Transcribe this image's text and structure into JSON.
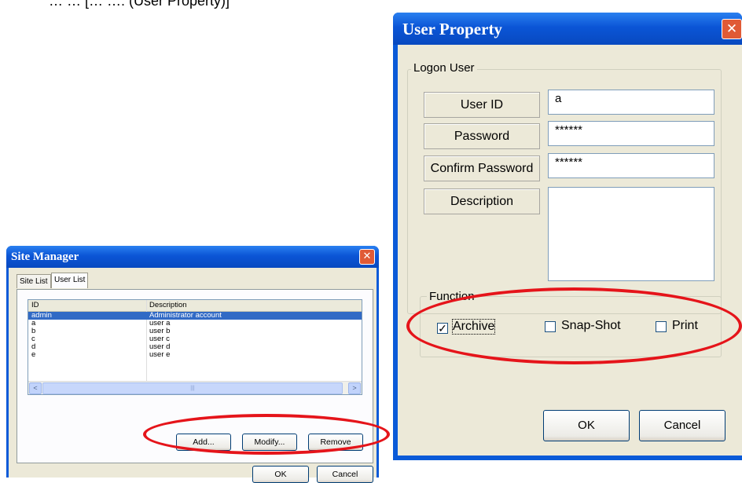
{
  "caption_fragment": "… … [… …: (User Property)]",
  "site_manager": {
    "title": "Site Manager",
    "close_glyph": "✕",
    "tabs": [
      "Site List",
      "User List"
    ],
    "columns": [
      "ID",
      "Description"
    ],
    "rows": [
      {
        "id": "admin",
        "desc": "Administrator account"
      },
      {
        "id": "a",
        "desc": "user a"
      },
      {
        "id": "b",
        "desc": "user b"
      },
      {
        "id": "c",
        "desc": "user c"
      },
      {
        "id": "d",
        "desc": "user d"
      },
      {
        "id": "e",
        "desc": "user e"
      }
    ],
    "scroll_thumb": "|||",
    "scroll_left": "<",
    "scroll_right": ">",
    "buttons": {
      "add": "Add...",
      "modify": "Modify...",
      "remove": "Remove",
      "ok": "OK",
      "cancel": "Cancel"
    }
  },
  "user_property": {
    "title": "User Property",
    "close_glyph": "✕",
    "logon_group": "Logon User",
    "labels": {
      "user_id": "User ID",
      "password": "Password",
      "confirm": "Confirm Password",
      "description": "Description"
    },
    "values": {
      "user_id": "a",
      "password": "******",
      "confirm": "******",
      "description": ""
    },
    "function_group": "Function",
    "functions": {
      "archive": {
        "label": "Archive",
        "checked": true
      },
      "snapshot": {
        "label": "Snap-Shot",
        "checked": false
      },
      "print": {
        "label": "Print",
        "checked": false
      }
    },
    "check_glyph": "✓",
    "buttons": {
      "ok": "OK",
      "cancel": "Cancel"
    }
  },
  "highlight_color": "#e5141a"
}
